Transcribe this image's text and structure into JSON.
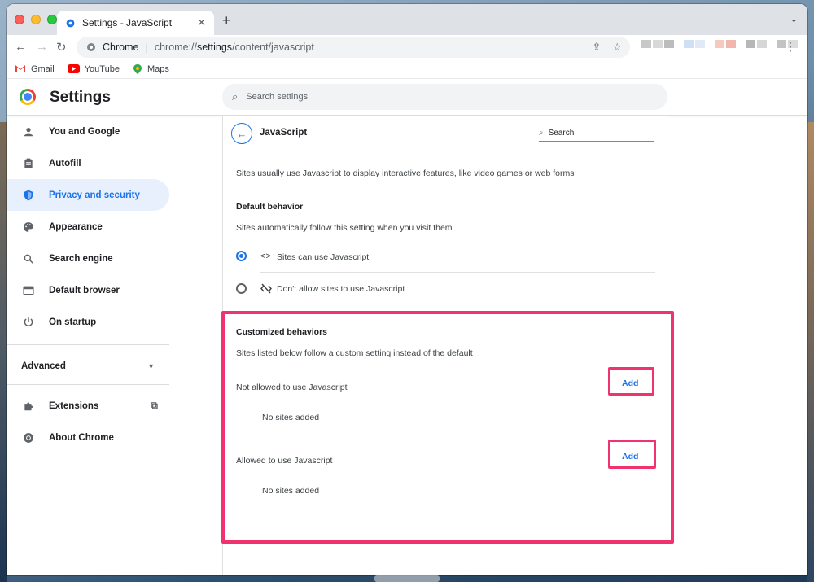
{
  "browser": {
    "tab_title": "Settings - JavaScript",
    "tab_close": "✕",
    "new_tab": "+",
    "tab_menu": "⌄",
    "omnibox_site": "Chrome",
    "omnibox_separator": "|",
    "omnibox_url_prefix": "chrome://",
    "omnibox_url_host": "settings",
    "omnibox_url_path": "/content/javascript",
    "bookmarks": [
      {
        "label": "Gmail",
        "icon": "gmail-icon",
        "color": "#ea4335"
      },
      {
        "label": "YouTube",
        "icon": "youtube-icon",
        "color": "#ff0000"
      },
      {
        "label": "Maps",
        "icon": "maps-icon",
        "color": "#34a853"
      }
    ]
  },
  "settings": {
    "title": "Settings",
    "search_placeholder": "Search settings"
  },
  "sidebar": {
    "items": [
      {
        "label": "You and Google",
        "icon": "person-icon",
        "glyph": "👤"
      },
      {
        "label": "Autofill",
        "icon": "clipboard-icon",
        "glyph": "📋"
      },
      {
        "label": "Privacy and security",
        "icon": "shield-icon",
        "glyph": "🛡"
      },
      {
        "label": "Appearance",
        "icon": "palette-icon",
        "glyph": "🎨"
      },
      {
        "label": "Search engine",
        "icon": "search-icon",
        "glyph": "🔍"
      },
      {
        "label": "Default browser",
        "icon": "browser-icon",
        "glyph": "▭"
      },
      {
        "label": "On startup",
        "icon": "power-icon",
        "glyph": "⏻"
      }
    ],
    "advanced_label": "Advanced",
    "extensions_label": "Extensions",
    "about_label": "About Chrome",
    "active_color": "#1a73e8"
  },
  "javascript_page": {
    "title": "JavaScript",
    "search_placeholder": "Search",
    "description": "Sites usually use Javascript to display interactive features, like video games or web forms",
    "default_behavior_heading": "Default behavior",
    "default_behavior_sub": "Sites automatically follow this setting when you visit them",
    "option_allow": "Sites can use Javascript",
    "option_block": "Don't allow sites to use Javascript",
    "selected_option": "Sites can use Javascript",
    "customized_heading": "Customized behaviors",
    "customized_sub": "Sites listed below follow a custom setting instead of the default",
    "not_allowed_label": "Not allowed to use Javascript",
    "not_allowed_add": "Add",
    "not_allowed_empty": "No sites added",
    "allowed_label": "Allowed to use Javascript",
    "allowed_add": "Add",
    "allowed_empty": "No sites added",
    "highlight_color": "#f0336e"
  }
}
